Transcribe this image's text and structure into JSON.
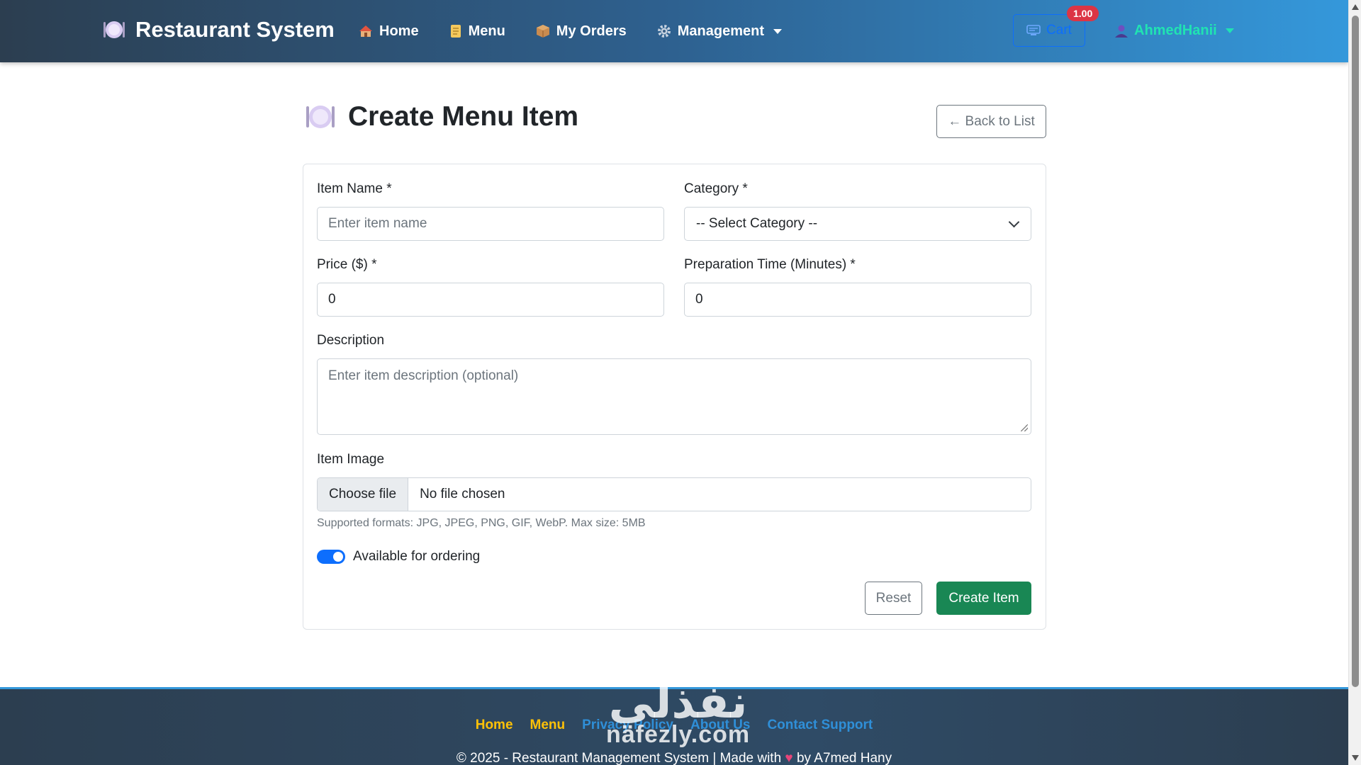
{
  "navbar": {
    "brand": "Restaurant System",
    "links": {
      "home": "Home",
      "menu": "Menu",
      "orders": "My Orders",
      "management": "Management"
    },
    "cart_label": "Cart",
    "cart_badge": "1.00",
    "username": "AhmedHanii"
  },
  "page": {
    "title": "Create Menu Item",
    "back_button": "← Back to List"
  },
  "form": {
    "item_name": {
      "label": "Item Name *",
      "placeholder": "Enter item name",
      "value": ""
    },
    "category": {
      "label": "Category *",
      "selected": "-- Select Category --"
    },
    "price": {
      "label": "Price ($) *",
      "value": "0"
    },
    "prep_time": {
      "label": "Preparation Time (Minutes) *",
      "value": "0"
    },
    "description": {
      "label": "Description",
      "placeholder": "Enter item description (optional)"
    },
    "image": {
      "label": "Item Image",
      "button": "Choose file",
      "status": "No file chosen",
      "help": "Supported formats: JPG, JPEG, PNG, GIF, WebP. Max size: 5MB"
    },
    "available": {
      "label": "Available for ordering",
      "checked": true
    },
    "reset_button": "Reset",
    "submit_button": "Create Item"
  },
  "footer": {
    "links": {
      "home": "Home",
      "menu": "Menu",
      "privacy": "Privacy Policy",
      "about": "About Us",
      "contact": "Contact Support"
    },
    "copyright_pre": "© 2025 - Restaurant Management System | Made with",
    "copyright_post": "by A7med Hany"
  },
  "watermark": {
    "arabic": "نفذلي",
    "latin": "nafezly.com"
  },
  "colors": {
    "primary": "#0d6efd",
    "success": "#198754",
    "danger": "#dc3545",
    "username": "#20e3b2",
    "footer_link_active": "#ffc107"
  },
  "icons": {
    "brand": "plate-icon",
    "home": "house-icon",
    "menu": "scroll-icon",
    "orders": "package-icon",
    "management": "gear-icon",
    "cart": "cart-icon",
    "user": "user-icon",
    "heart": "heart-icon"
  }
}
